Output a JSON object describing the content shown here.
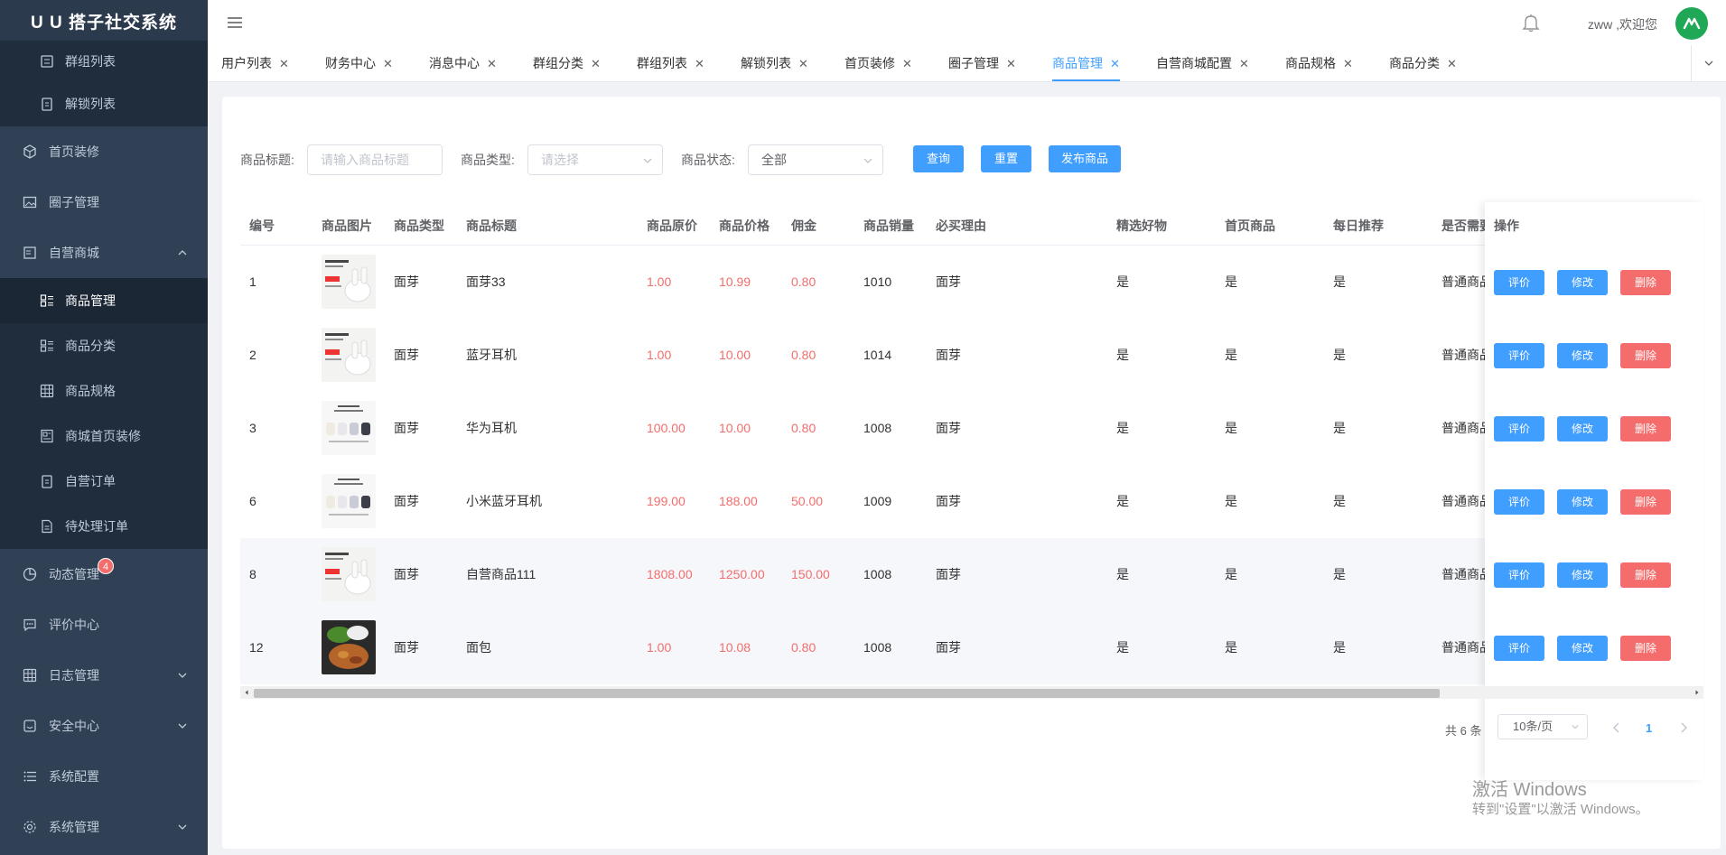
{
  "brand": "U U 搭子社交系统",
  "sidebar": {
    "items": [
      {
        "label": "群组列表",
        "sub": true
      },
      {
        "label": "解锁列表",
        "sub": true
      },
      {
        "label": "首页装修"
      },
      {
        "label": "圈子管理"
      },
      {
        "label": "自营商城",
        "expanded": true
      },
      {
        "label": "商品管理",
        "sub": true,
        "active": true
      },
      {
        "label": "商品分类",
        "sub": true
      },
      {
        "label": "商品规格",
        "sub": true
      },
      {
        "label": "商城首页装修",
        "sub": true
      },
      {
        "label": "自营订单",
        "sub": true
      },
      {
        "label": "待处理订单",
        "sub": true
      },
      {
        "label": "动态管理",
        "badge": "4"
      },
      {
        "label": "评价中心"
      },
      {
        "label": "日志管理"
      },
      {
        "label": "安全中心"
      },
      {
        "label": "系统配置"
      },
      {
        "label": "系统管理"
      }
    ]
  },
  "header": {
    "username": "zww ,欢迎您"
  },
  "tabs": [
    "用户列表",
    "财务中心",
    "消息中心",
    "群组分类",
    "群组列表",
    "解锁列表",
    "首页装修",
    "圈子管理",
    "商品管理",
    "自营商城配置",
    "商品规格",
    "商品分类"
  ],
  "active_tab": "商品管理",
  "filters": {
    "title_label": "商品标题:",
    "title_placeholder": "请输入商品标题",
    "type_label": "商品类型:",
    "type_placeholder": "请选择",
    "status_label": "商品状态:",
    "status_value": "全部",
    "query": "查询",
    "reset": "重置",
    "publish": "发布商品"
  },
  "table": {
    "headers": [
      "编号",
      "商品图片",
      "商品类型",
      "商品标题",
      "商品原价",
      "商品价格",
      "佣金",
      "商品销量",
      "必买理由",
      "精选好物",
      "首页商品",
      "每日推荐",
      "是否需要",
      "操作"
    ],
    "rows": [
      {
        "id": "1",
        "img": "earbuds-white",
        "type": "面芽",
        "title": "面芽33",
        "orig": "1.00",
        "price": "10.99",
        "comm": "0.80",
        "sales": "1010",
        "reason": "面芽",
        "pick": "是",
        "home": "是",
        "daily": "是",
        "need": "普通商品"
      },
      {
        "id": "2",
        "img": "earbuds-white",
        "type": "面芽",
        "title": "蓝牙耳机",
        "orig": "1.00",
        "price": "10.00",
        "comm": "0.80",
        "sales": "1014",
        "reason": "面芽",
        "pick": "是",
        "home": "是",
        "daily": "是",
        "need": "普通商品"
      },
      {
        "id": "3",
        "img": "earbuds-multi",
        "type": "面芽",
        "title": "华为耳机",
        "orig": "100.00",
        "price": "10.00",
        "comm": "0.80",
        "sales": "1008",
        "reason": "面芽",
        "pick": "是",
        "home": "是",
        "daily": "是",
        "need": "普通商品"
      },
      {
        "id": "6",
        "img": "earbuds-multi",
        "type": "面芽",
        "title": "小米蓝牙耳机",
        "orig": "199.00",
        "price": "188.00",
        "comm": "50.00",
        "sales": "1009",
        "reason": "面芽",
        "pick": "是",
        "home": "是",
        "daily": "是",
        "need": "普通商品"
      },
      {
        "id": "8",
        "img": "earbuds-white",
        "type": "面芽",
        "title": "自营商品111",
        "orig": "1808.00",
        "price": "1250.00",
        "comm": "150.00",
        "sales": "1008",
        "reason": "面芽",
        "pick": "是",
        "home": "是",
        "daily": "是",
        "need": "普通商品"
      },
      {
        "id": "12",
        "img": "food-dark",
        "type": "面芽",
        "title": "面包",
        "orig": "1.00",
        "price": "10.08",
        "comm": "0.80",
        "sales": "1008",
        "reason": "面芽",
        "pick": "是",
        "home": "是",
        "daily": "是",
        "need": "普通商品"
      }
    ],
    "actions": {
      "review": "评价",
      "edit": "修改",
      "delete": "删除"
    }
  },
  "pager": {
    "total": "共 6 条",
    "size": "10条/页",
    "page": "1"
  },
  "watermark": {
    "line1": "激活 Windows",
    "line2": "转到\"设置\"以激活 Windows。"
  },
  "colors": {
    "sidebar_bg": "#304156",
    "primary": "#409eff",
    "danger": "#f56c6c"
  }
}
